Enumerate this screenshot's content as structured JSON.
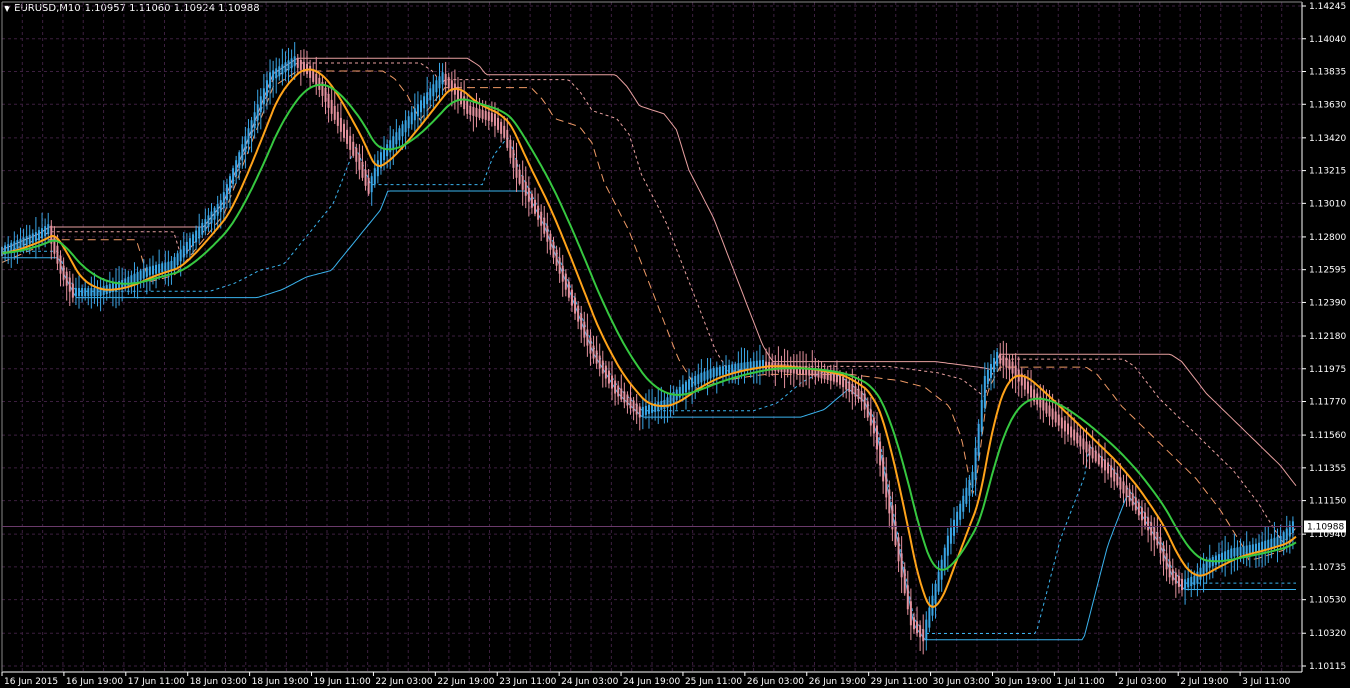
{
  "header": {
    "symbol_tf": "EURUSD,M10",
    "ohlc": "1.10957 1.11060 1.10924 1.10988"
  },
  "colors": {
    "background": "#000000",
    "grid": "#3c1f3f",
    "axis": "#ffffff",
    "bull": "#3aa6e6",
    "bear": "#e5929e",
    "ma_green": "#36c840",
    "ma_orange": "#ffa31a",
    "line_blue": "#3ab3ee",
    "line_pink": "#e8a0a0",
    "line_salmon": "#ef9a66"
  },
  "chart_data": {
    "type": "candlestick",
    "symbol": "EURUSD",
    "timeframe": "M10",
    "current_price": "1.10988",
    "ylim": [
      1.10115,
      1.14245
    ],
    "y_ticks": [
      "1.14245",
      "1.14040",
      "1.13835",
      "1.13630",
      "1.13420",
      "1.13215",
      "1.13010",
      "1.12800",
      "1.12595",
      "1.12390",
      "1.12180",
      "1.11975",
      "1.11770",
      "1.11560",
      "1.11355",
      "1.11150",
      "1.10940",
      "1.10735",
      "1.10530",
      "1.10320",
      "1.10115"
    ],
    "x_ticks": [
      "16 Jun 2015",
      "16 Jun 19:00",
      "17 Jun 11:00",
      "18 Jun 03:00",
      "18 Jun 19:00",
      "19 Jun 11:00",
      "22 Jun 03:00",
      "22 Jun 19:00",
      "23 Jun 11:00",
      "24 Jun 03:00",
      "24 Jun 19:00",
      "25 Jun 11:00",
      "26 Jun 03:00",
      "26 Jun 19:00",
      "29 Jun 11:00",
      "30 Jun 03:00",
      "30 Jun 19:00",
      "1 Jul 11:00",
      "2 Jul 03:00",
      "2 Jul 19:00",
      "3 Jul 11:00"
    ],
    "price_path": [
      [
        0,
        1.127
      ],
      [
        3,
        1.128
      ],
      [
        4,
        1.1285
      ],
      [
        5,
        1.126
      ],
      [
        6,
        1.1245
      ],
      [
        8,
        1.1245
      ],
      [
        10,
        1.125
      ],
      [
        12,
        1.1258
      ],
      [
        14,
        1.1262
      ],
      [
        18,
        1.13
      ],
      [
        20,
        1.134
      ],
      [
        22,
        1.138
      ],
      [
        24,
        1.139
      ],
      [
        25,
        1.1385
      ],
      [
        26,
        1.1375
      ],
      [
        27,
        1.136
      ],
      [
        29,
        1.133
      ],
      [
        30,
        1.131
      ],
      [
        31,
        1.133
      ],
      [
        33,
        1.135
      ],
      [
        35,
        1.137
      ],
      [
        36,
        1.138
      ],
      [
        37,
        1.1372
      ],
      [
        38,
        1.136
      ],
      [
        40,
        1.1355
      ],
      [
        41,
        1.1345
      ],
      [
        42,
        1.132
      ],
      [
        44,
        1.129
      ],
      [
        46,
        1.125
      ],
      [
        48,
        1.121
      ],
      [
        50,
        1.1185
      ],
      [
        52,
        1.117
      ],
      [
        54,
        1.1175
      ],
      [
        56,
        1.1188
      ],
      [
        57,
        1.1192
      ],
      [
        58,
        1.1195
      ],
      [
        60,
        1.1198
      ],
      [
        62,
        1.12
      ],
      [
        64,
        1.1198
      ],
      [
        66,
        1.1196
      ],
      [
        68,
        1.1192
      ],
      [
        70,
        1.118
      ],
      [
        71,
        1.116
      ],
      [
        72,
        1.112
      ],
      [
        73,
        1.108
      ],
      [
        74,
        1.104
      ],
      [
        75,
        1.103
      ],
      [
        76,
        1.106
      ],
      [
        77,
        1.109
      ],
      [
        79,
        1.113
      ],
      [
        80,
        1.119
      ],
      [
        81,
        1.1205
      ],
      [
        82,
        1.12
      ],
      [
        83,
        1.119
      ],
      [
        84,
        1.118
      ],
      [
        86,
        1.1165
      ],
      [
        88,
        1.115
      ],
      [
        90,
        1.1135
      ],
      [
        92,
        1.1115
      ],
      [
        94,
        1.109
      ],
      [
        95,
        1.107
      ],
      [
        96,
        1.1062
      ],
      [
        97,
        1.1065
      ],
      [
        98,
        1.1075
      ],
      [
        100,
        1.1082
      ],
      [
        102,
        1.1085
      ],
      [
        104,
        1.109
      ],
      [
        105,
        1.1099
      ]
    ]
  }
}
